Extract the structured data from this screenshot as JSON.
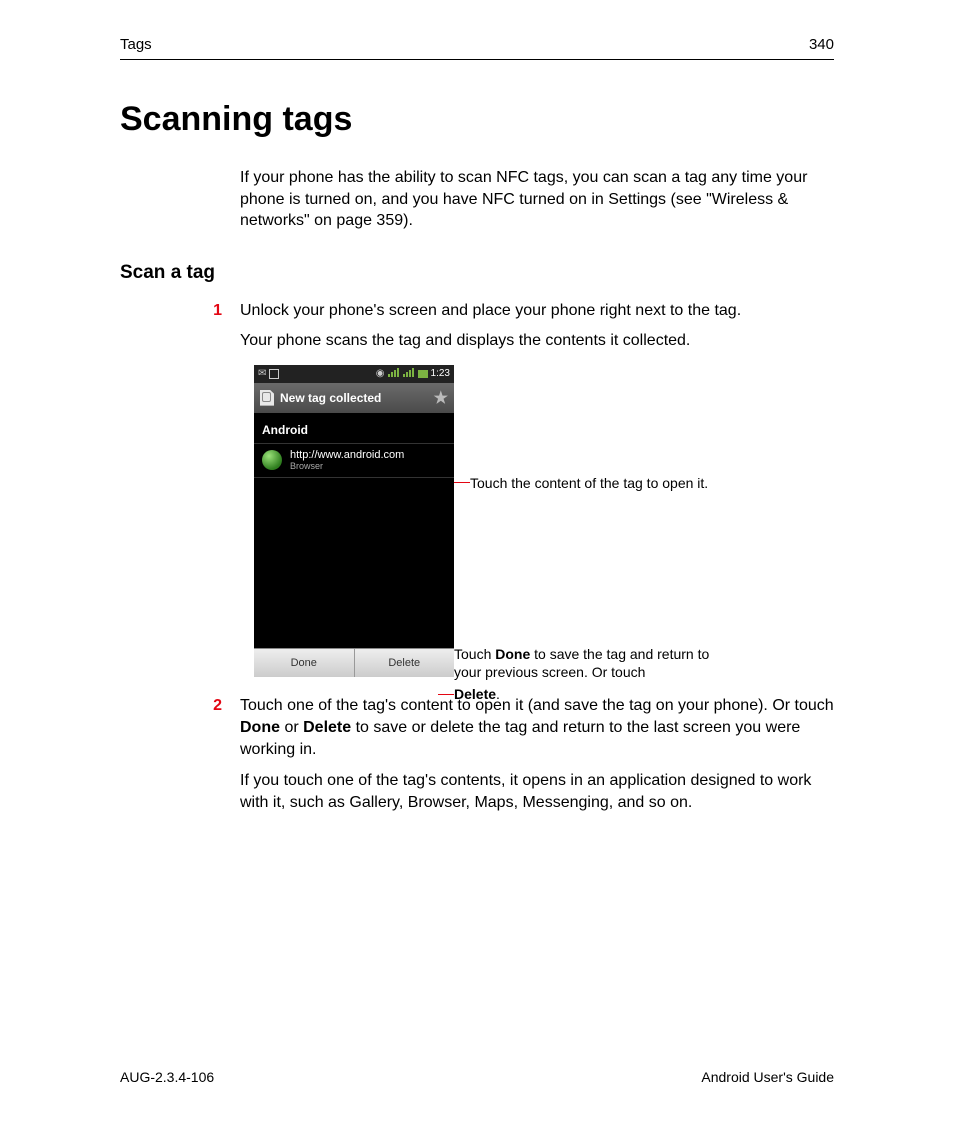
{
  "header": {
    "section": "Tags",
    "page_number": "340"
  },
  "title": "Scanning tags",
  "intro": "If your phone has the ability to scan NFC tags, you can scan a tag any time your phone is turned on, and you have NFC turned on in Settings (see \"Wireless & networks\" on page 359).",
  "subheading": "Scan a tag",
  "step1_num": "1",
  "step1_text": "Unlock your phone's screen and place your phone right next to the tag.",
  "step1_follow": "Your phone scans the tag and displays the contents it collected.",
  "phone": {
    "time": "1:23",
    "titlebar": "New tag collected",
    "section": "Android",
    "url": "http://www.android.com",
    "url_sub": "Browser",
    "btn_done": "Done",
    "btn_delete": "Delete"
  },
  "callout_open": "Touch the content of the tag to open it.",
  "callout_done_pre": "Touch ",
  "callout_done_b1": "Done",
  "callout_done_mid": " to save the tag and return to your previous screen. Or touch ",
  "callout_done_b2": "Delete",
  "callout_done_post": ".",
  "step2_num": "2",
  "step2_pre": "Touch one of the tag's content to open it (and save the tag on your phone). Or touch ",
  "step2_b1": "Done",
  "step2_mid": " or ",
  "step2_b2": "Delete",
  "step2_post": " to save or delete the tag and return to the last screen you were working in.",
  "step2_follow": "If you touch one of the tag's contents, it opens in an application designed to work with it, such as Gallery, Browser, Maps, Messenging, and so on.",
  "footer": {
    "left": "AUG-2.3.4-106",
    "right": "Android User's Guide"
  }
}
